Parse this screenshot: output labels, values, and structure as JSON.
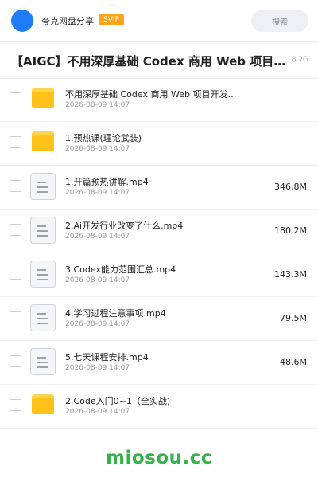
{
  "header": {
    "brand": "夸克网盘分享",
    "badge": "SVIP",
    "search_label": "搜索"
  },
  "share": {
    "title": "【AIGC】不用深厚基础 Codex 商用 Web 项目开发…",
    "total_size": "8.2G"
  },
  "files": [
    {
      "type": "folder",
      "icon": "folder-icon",
      "name": "不用深厚基础 Codex 商用 Web 项目开发 …",
      "date": "2026-08-09 14:07",
      "size": ""
    },
    {
      "type": "folder",
      "icon": "folder-icon",
      "name": "1.预热课(理论武装)",
      "date": "2026-08-09 14:07",
      "size": ""
    },
    {
      "type": "file",
      "icon": "video-file-icon",
      "name": "1.开篇预热讲解.mp4",
      "date": "2026-08-09 14:07",
      "size": "346.8M"
    },
    {
      "type": "file",
      "icon": "video-file-icon",
      "name": "2.Ai开发行业改变了什么.mp4",
      "date": "2026-08-09 14:07",
      "size": "180.2M"
    },
    {
      "type": "file",
      "icon": "video-file-icon",
      "name": "3.Codex能力范围汇总.mp4",
      "date": "2026-08-09 14:07",
      "size": "143.3M"
    },
    {
      "type": "file",
      "icon": "video-file-icon",
      "name": "4.学习过程注意事项.mp4",
      "date": "2026-08-09 14:07",
      "size": "79.5M"
    },
    {
      "type": "file",
      "icon": "video-file-icon",
      "name": "5.七天课程安排.mp4",
      "date": "2026-08-09 14:07",
      "size": "48.6M"
    },
    {
      "type": "folder",
      "icon": "folder-icon",
      "name": "2.Code入门0~1（全实战)",
      "date": "2026-08-09 14:07",
      "size": ""
    }
  ],
  "watermark": "miosou.cc",
  "colors": {
    "avatar": "#1e7df7",
    "badge": "#ffa31a",
    "folder": "#ffc21a",
    "watermark": "#35b24a"
  }
}
